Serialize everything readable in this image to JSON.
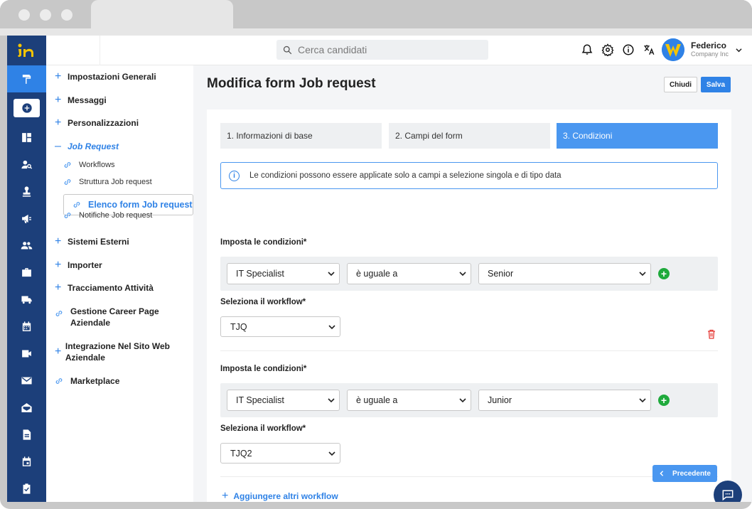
{
  "topbar": {
    "search_placeholder": "Cerca candidati",
    "icons": [
      "bell-icon",
      "gear-icon",
      "info-icon",
      "translate-icon"
    ],
    "user": {
      "name": "Federico",
      "company": "Company Inc"
    }
  },
  "rail": {
    "icons": [
      "paint-roller-icon",
      "add-icon",
      "dashboard-icon",
      "person-search-icon",
      "stamp-icon",
      "megaphone-icon",
      "people-icon",
      "briefcase-icon",
      "truck-icon",
      "calendar-icon",
      "video-icon",
      "mail-icon",
      "mail-open-icon",
      "document-icon",
      "event-icon",
      "clipboard-check-icon"
    ]
  },
  "sidebar": {
    "items": [
      {
        "label": "Impostazioni Generali"
      },
      {
        "label": "Messaggi"
      },
      {
        "label": "Personalizzazioni"
      },
      {
        "label": "Job Request"
      },
      {
        "label": "Sistemi Esterni"
      },
      {
        "label": "Importer"
      },
      {
        "label": "Tracciamento Attività"
      },
      {
        "label": "Gestione Career Page Aziendale"
      },
      {
        "label": "Integrazione Nel Sito Web Aziendale"
      },
      {
        "label": "Marketplace"
      }
    ],
    "subitems": [
      {
        "label": "Workflows"
      },
      {
        "label": "Struttura Job request"
      },
      {
        "label": "Elenco form Job request"
      },
      {
        "label": "Notifiche Job request"
      }
    ]
  },
  "main": {
    "title": "Modifica form Job request",
    "close_label": "Chiudi",
    "save_label": "Salva",
    "steps": [
      {
        "label": "1. Informazioni di base"
      },
      {
        "label": "2. Campi del form"
      },
      {
        "label": "3. Condizioni"
      }
    ],
    "info_text": "Le condizioni possono essere applicate solo a campi a selezione singola e di tipo data",
    "conditions": [
      {
        "conditions_label": "Imposta le condizioni*",
        "field": "IT Specialist",
        "operator": "è uguale a",
        "value": "Senior",
        "workflow_label": "Seleziona il workflow*",
        "workflow": "TJQ"
      },
      {
        "conditions_label": "Imposta le condizioni*",
        "field": "IT Specialist",
        "operator": "è uguale a",
        "value": "Junior",
        "workflow_label": "Seleziona il workflow*",
        "workflow": "TJQ2"
      }
    ],
    "add_more_label": "Aggiungere altri workflow",
    "prev_label": "Precedente"
  },
  "colors": {
    "rail": "#1c3f7a",
    "accent": "#2f82e6",
    "green": "#1faa3c",
    "danger": "#e53935"
  }
}
